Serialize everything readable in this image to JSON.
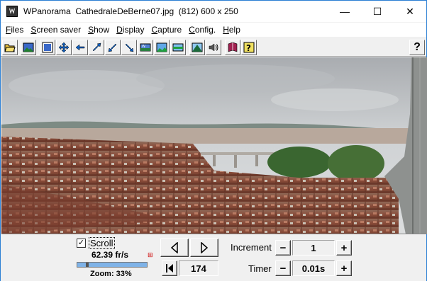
{
  "window": {
    "title": "WPanorama  CathedraleDeBerne07.jpg  (812) 600 x 250",
    "controls": {
      "minimize": "—",
      "maximize": "☐",
      "close": "✕"
    }
  },
  "menu": [
    {
      "label": "Files",
      "access": "F",
      "rest": "iles"
    },
    {
      "label": "Screen saver",
      "access": "S",
      "rest": "creen saver"
    },
    {
      "label": "Show",
      "access": "S",
      "rest": "how"
    },
    {
      "label": "Display",
      "access": "D",
      "rest": "isplay"
    },
    {
      "label": "Capture",
      "access": "C",
      "rest": "apture"
    },
    {
      "label": "Config.",
      "access": "C",
      "rest": "onfig."
    },
    {
      "label": "Help",
      "access": "H",
      "rest": "elp"
    }
  ],
  "toolbar": {
    "help_label": "?"
  },
  "controls": {
    "scroll_checked": "✓",
    "scroll_label": "Scroll",
    "fps": "62.39 fr/s",
    "speed_fraction": 0.13,
    "zoom": "Zoom: 33%",
    "frame_value": "174",
    "increment_label": "Increment",
    "increment_value": "1",
    "timer_label": "Timer",
    "timer_value": "0.01s",
    "minus": "−",
    "plus": "+"
  },
  "colors": {
    "accent": "#2b7fd4",
    "slider_fill": "#7fb3e8"
  }
}
